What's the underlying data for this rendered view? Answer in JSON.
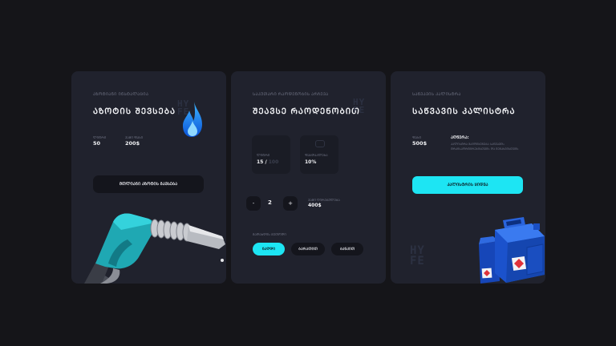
{
  "card1": {
    "kicker": "ᲐᲖᲝᲢᲘᲐᲜᲘ ᲘᲜᲡᲢᲐᲚᲐᲪᲘᲐ",
    "title": "ᲐᲖᲝᲢᲘᲡ ᲨᲔᲕᲡᲔᲑᲐ",
    "amount_label": "ᲚᲘᲢᲠᲘ",
    "amount_value": "50",
    "price_label": "ᲯᲐᲛᲘ ᲤᲐᲡᲘ",
    "price_value": "200$",
    "button": "ᲛᲗᲚᲘᲐᲜᲘ ᲐᲖᲝᲢᲘᲡ ᲒᲐᲕᲡᲔᲑᲐ",
    "flame_icon": "flame-icon",
    "pump_image": "fuel-nozzle"
  },
  "card2": {
    "kicker": "ᲡᲐᲙᲣᲗᲐᲠᲘ ᲠᲐᲝᲓᲔᲜᲝᲑᲘᲡ ᲐᲠᲩᲔᲕᲐ",
    "title": "ᲨᲔᲐᲕᲡᲔ ᲠᲐᲝᲓᲔᲜᲝᲑᲘᲗ",
    "box1_label": "ᲚᲘᲢᲠᲘ",
    "box1_value": "15 /",
    "box1_suffix": "100",
    "box2_label": "ᲤᲐᲡᲓᲐᲙᲚᲔᲑᲐ",
    "box2_value": "10%",
    "minus": "-",
    "qty": "2",
    "plus": "+",
    "total_label": "ᲯᲐᲛᲘ ᲦᲘᲠᲔᲑᲣᲚᲔᲑᲐ",
    "total_value": "400$",
    "payment_label": "ᲒᲐᲓᲐᲮᲓᲘᲡ ᲛᲔᲗᲝᲓᲘ",
    "pills": [
      "ᲜᲐᲦᲓᲘ",
      "ᲑᲐᲠᲐᲗᲘᲗ",
      "ᲑᲐᲜᲙᲘᲗ"
    ],
    "active_pill": 0
  },
  "card3": {
    "kicker": "ᲡᲐᲬᲕᲐᲕᲘᲡ ᲙᲐᲚᲘᲡᲢᲠᲐ",
    "title": "ᲡᲐᲬᲕᲐᲕᲘᲡ ᲙᲐᲚᲘᲡᲢᲠᲐ",
    "price_label": "ᲤᲐᲡᲘ",
    "price_value": "500$",
    "desc_title": "ᲐᲦᲬᲔᲠᲐ:",
    "desc_text": "ᲙᲐᲚᲘᲡᲢᲠᲐ ᲒᲐᲛᲝᲘᲧᲔᲜᲔᲑᲐ ᲡᲐᲬᲕᲐᲕᲘᲡ ᲢᲠᲐᲜᲡᲞᲝᲠᲢᲘᲠᲔᲑᲘᲡᲗᲕᲘᲡ ᲓᲐ ᲨᲔᲜᲐᲮᲕᲘᲡᲗᲕᲘᲡ",
    "button": "ᲙᲐᲚᲘᲡᲢᲠᲘᲡ ᲧᲘᲓᲕᲐ",
    "canister_image": "jerry-can"
  },
  "watermark": [
    "HY",
    "FE"
  ],
  "colors": {
    "accent": "#1de5f3",
    "card": "#20222d",
    "bg": "#151519",
    "button_dark": "#14151c"
  }
}
